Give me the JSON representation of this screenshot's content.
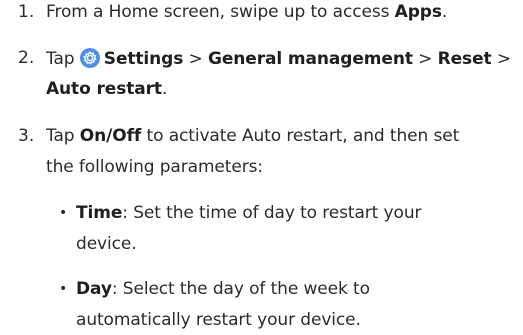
{
  "steps": [
    {
      "number": "1.",
      "line1": {
        "pre": "From a Home screen, swipe up to access ",
        "bold": "Apps",
        "post": "."
      }
    },
    {
      "number": "2.",
      "line1": {
        "pre": "Tap ",
        "settings": "Settings",
        "sep1": " > ",
        "general": "General management",
        "sep2": " > ",
        "reset": "Reset",
        "sep3": " >"
      },
      "line2": {
        "bold": "Auto restart",
        "post": "."
      }
    },
    {
      "number": "3.",
      "line1": {
        "pre": "Tap ",
        "bold": "On/Off",
        "post": " to activate Auto restart, and then set"
      },
      "line2": "the following parameters:"
    }
  ],
  "bullets": [
    {
      "symbol": "•",
      "line1": {
        "bold": "Time",
        "post": ": Set the time of day to restart your"
      },
      "line2": "device."
    },
    {
      "symbol": "•",
      "line1": {
        "bold": "Day",
        "post": ": Select the day of the week to"
      },
      "line2": "automatically restart your device."
    }
  ],
  "icons": {
    "settings": "settings-gear-icon"
  },
  "colors": {
    "settings_icon_bg": "#4d8fe6",
    "text": "#2b2b2b"
  }
}
